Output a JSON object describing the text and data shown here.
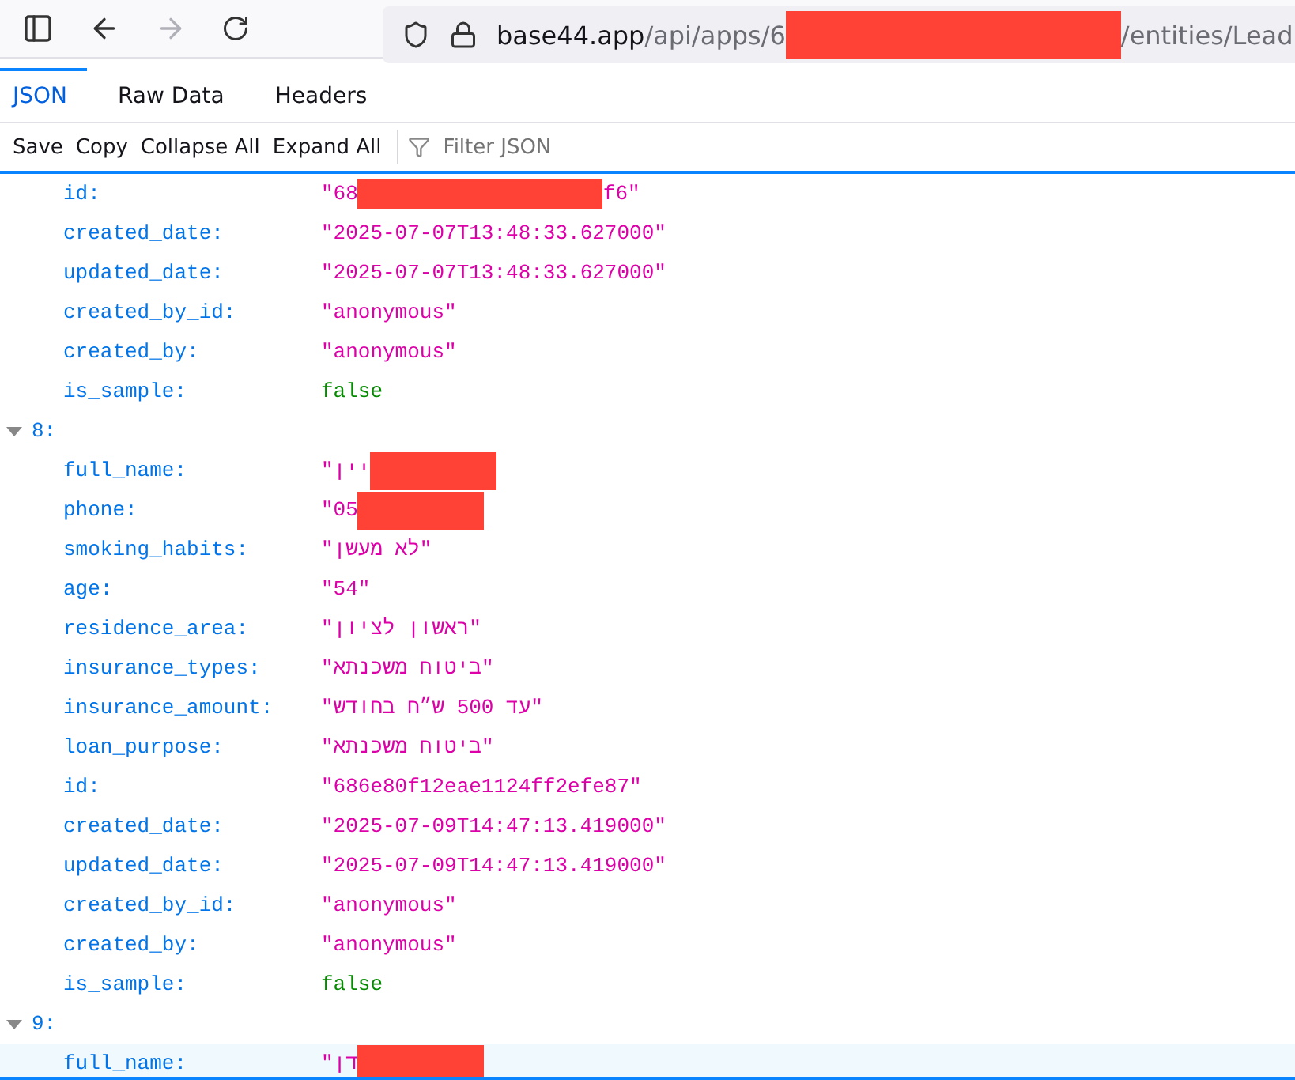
{
  "browser": {
    "url_host": "base44.app",
    "url_path_start": "/api/apps/6",
    "url_redacted": true,
    "url_path_end": "/entities/Lead"
  },
  "tabs": [
    {
      "label": "JSON",
      "selected": true
    },
    {
      "label": "Raw Data",
      "selected": false
    },
    {
      "label": "Headers",
      "selected": false
    }
  ],
  "toolbar": {
    "buttons": [
      "Save",
      "Copy",
      "Collapse All",
      "Expand All"
    ],
    "filter": {
      "placeholder": "Filter JSON"
    }
  },
  "rows": [
    {
      "kind": "string",
      "key": "id:",
      "value": "\"68",
      "redacted": true,
      "value_after": "f6\"",
      "selected": false
    },
    {
      "kind": "string",
      "key": "created_date:",
      "value": "\"2025-07-07T13:48:33.627000\"",
      "selected": false
    },
    {
      "kind": "string",
      "key": "updated_date:",
      "value": "\"2025-07-07T13:48:33.627000\"",
      "selected": false
    },
    {
      "kind": "string",
      "key": "created_by_id:",
      "value": "\"anonymous\"",
      "selected": false
    },
    {
      "kind": "string",
      "key": "created_by:",
      "value": "\"anonymous\"",
      "selected": false
    },
    {
      "kind": "boolean",
      "key": "is_sample:",
      "value": "false",
      "selected": false
    },
    {
      "kind": "header",
      "key": "8:",
      "expanded": true
    },
    {
      "kind": "string",
      "key": "full_name:",
      "value": "\"יין",
      "redacted": true,
      "selected": false
    },
    {
      "kind": "string",
      "key": "phone:",
      "value": "\"05",
      "redacted": true,
      "selected": false
    },
    {
      "kind": "string",
      "key": "smoking_habits:",
      "value": "\"לא מעשן\"",
      "selected": false
    },
    {
      "kind": "string",
      "key": "age:",
      "value": "\"54\"",
      "selected": false
    },
    {
      "kind": "string",
      "key": "residence_area:",
      "value": "\"ראשון לציון\"",
      "selected": false
    },
    {
      "kind": "string",
      "key": "insurance_types:",
      "value": "\"ביטוח משכנתא\"",
      "selected": false
    },
    {
      "kind": "string",
      "key": "insurance_amount:",
      "value": "\"עד 500 ש״ח בחודש\"",
      "selected": false
    },
    {
      "kind": "string",
      "key": "loan_purpose:",
      "value": "\"ביטוח משכנתא\"",
      "selected": false
    },
    {
      "kind": "string",
      "key": "id:",
      "value": "\"686e80f12eae1124ff2efe87\"",
      "selected": false
    },
    {
      "kind": "string",
      "key": "created_date:",
      "value": "\"2025-07-09T14:47:13.419000\"",
      "selected": false
    },
    {
      "kind": "string",
      "key": "updated_date:",
      "value": "\"2025-07-09T14:47:13.419000\"",
      "selected": false
    },
    {
      "kind": "string",
      "key": "created_by_id:",
      "value": "\"anonymous\"",
      "selected": false
    },
    {
      "kind": "string",
      "key": "created_by:",
      "value": "\"anonymous\"",
      "selected": false
    },
    {
      "kind": "boolean",
      "key": "is_sample:",
      "value": "false",
      "selected": false
    },
    {
      "kind": "header",
      "key": "9:",
      "expanded": true
    },
    {
      "kind": "string",
      "key": "full_name:",
      "value": "\"דן",
      "redacted": true,
      "selected": true
    }
  ]
}
